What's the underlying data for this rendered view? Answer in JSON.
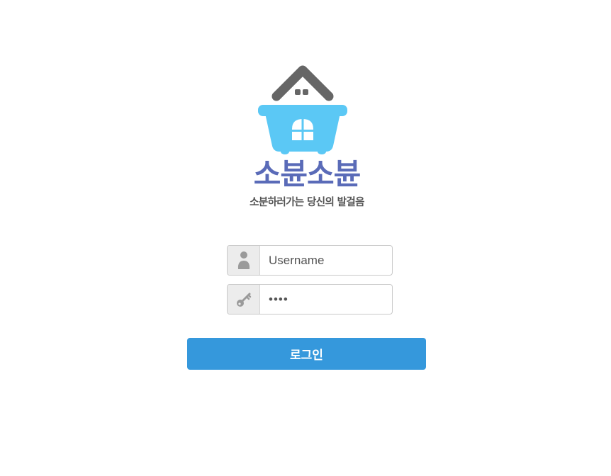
{
  "brand": {
    "title": "소뷴소뷴",
    "subtitle": "소분하러가는 당신의 발걸음",
    "title_color": "#5a6bb8",
    "roof_color": "#666666",
    "tub_color": "#5bc8f5"
  },
  "login_form": {
    "username_placeholder": "Username",
    "username_icon": "user-icon",
    "password_value": "••••",
    "password_icon": "key-icon",
    "submit_label": "로그인",
    "submit_color": "#3598dc"
  }
}
